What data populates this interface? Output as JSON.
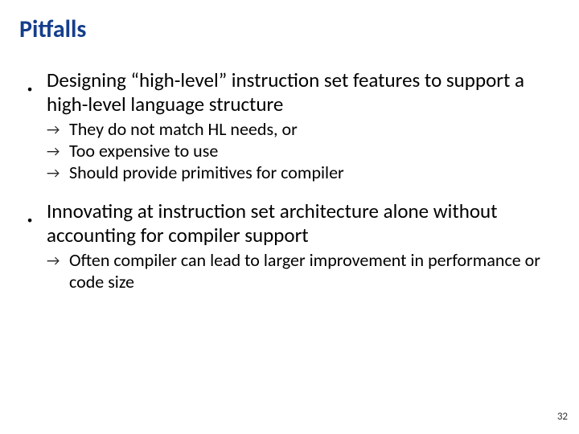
{
  "title": "Pitfalls",
  "items": [
    {
      "text": "Designing “high-level” instruction set features to support a high-level language structure",
      "sub": [
        "They do not match HL needs, or",
        "Too expensive to use",
        "Should provide primitives for compiler"
      ]
    },
    {
      "text": "Innovating at instruction set architecture alone without accounting for compiler support",
      "sub": [
        "Often compiler can lead to larger improvement in performance or code size"
      ]
    }
  ],
  "page_number": "32"
}
